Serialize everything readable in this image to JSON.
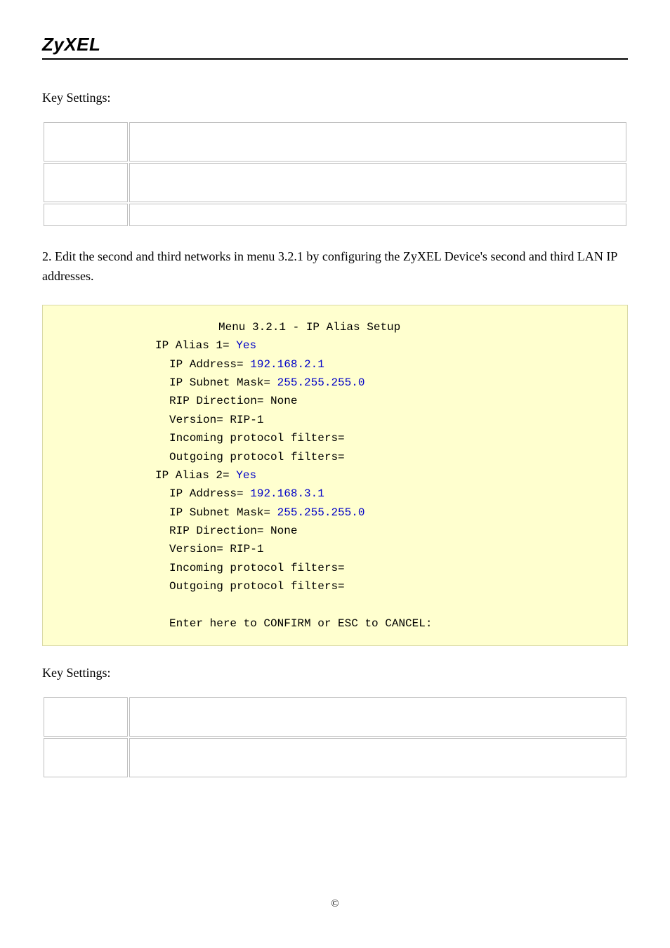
{
  "header": {
    "brand": "ZyXEL"
  },
  "section1_label": "Key Settings:",
  "para2": "2. Edit the second and third networks in menu 3.2.1 by configuring the ZyXEL Device's second and third LAN IP addresses.",
  "terminal": {
    "menu_title": "Menu 3.2.1 - IP Alias Setup",
    "alias1": {
      "label": "IP Alias 1=",
      "value": "Yes",
      "ip_label": "IP Address=",
      "ip_value": "192.168.2.1",
      "mask_label": "IP Subnet Mask=",
      "mask_value": "255.255.255.0",
      "rip_dir": "RIP Direction= None",
      "version": "Version= RIP-1",
      "in_filters": "Incoming protocol filters=",
      "out_filters": "Outgoing protocol filters="
    },
    "alias2": {
      "label": "IP Alias 2=",
      "value": "Yes",
      "ip_label": "IP Address=",
      "ip_value": "192.168.3.1",
      "mask_label": "IP Subnet Mask=",
      "mask_value": "255.255.255.0",
      "rip_dir": "RIP Direction= None",
      "version": "Version= RIP-1",
      "in_filters": "Incoming protocol filters=",
      "out_filters": "Outgoing protocol filters="
    },
    "footer": "Enter here to CONFIRM or ESC to CANCEL:"
  },
  "section2_label": "Key Settings:",
  "footer_copy": "©"
}
